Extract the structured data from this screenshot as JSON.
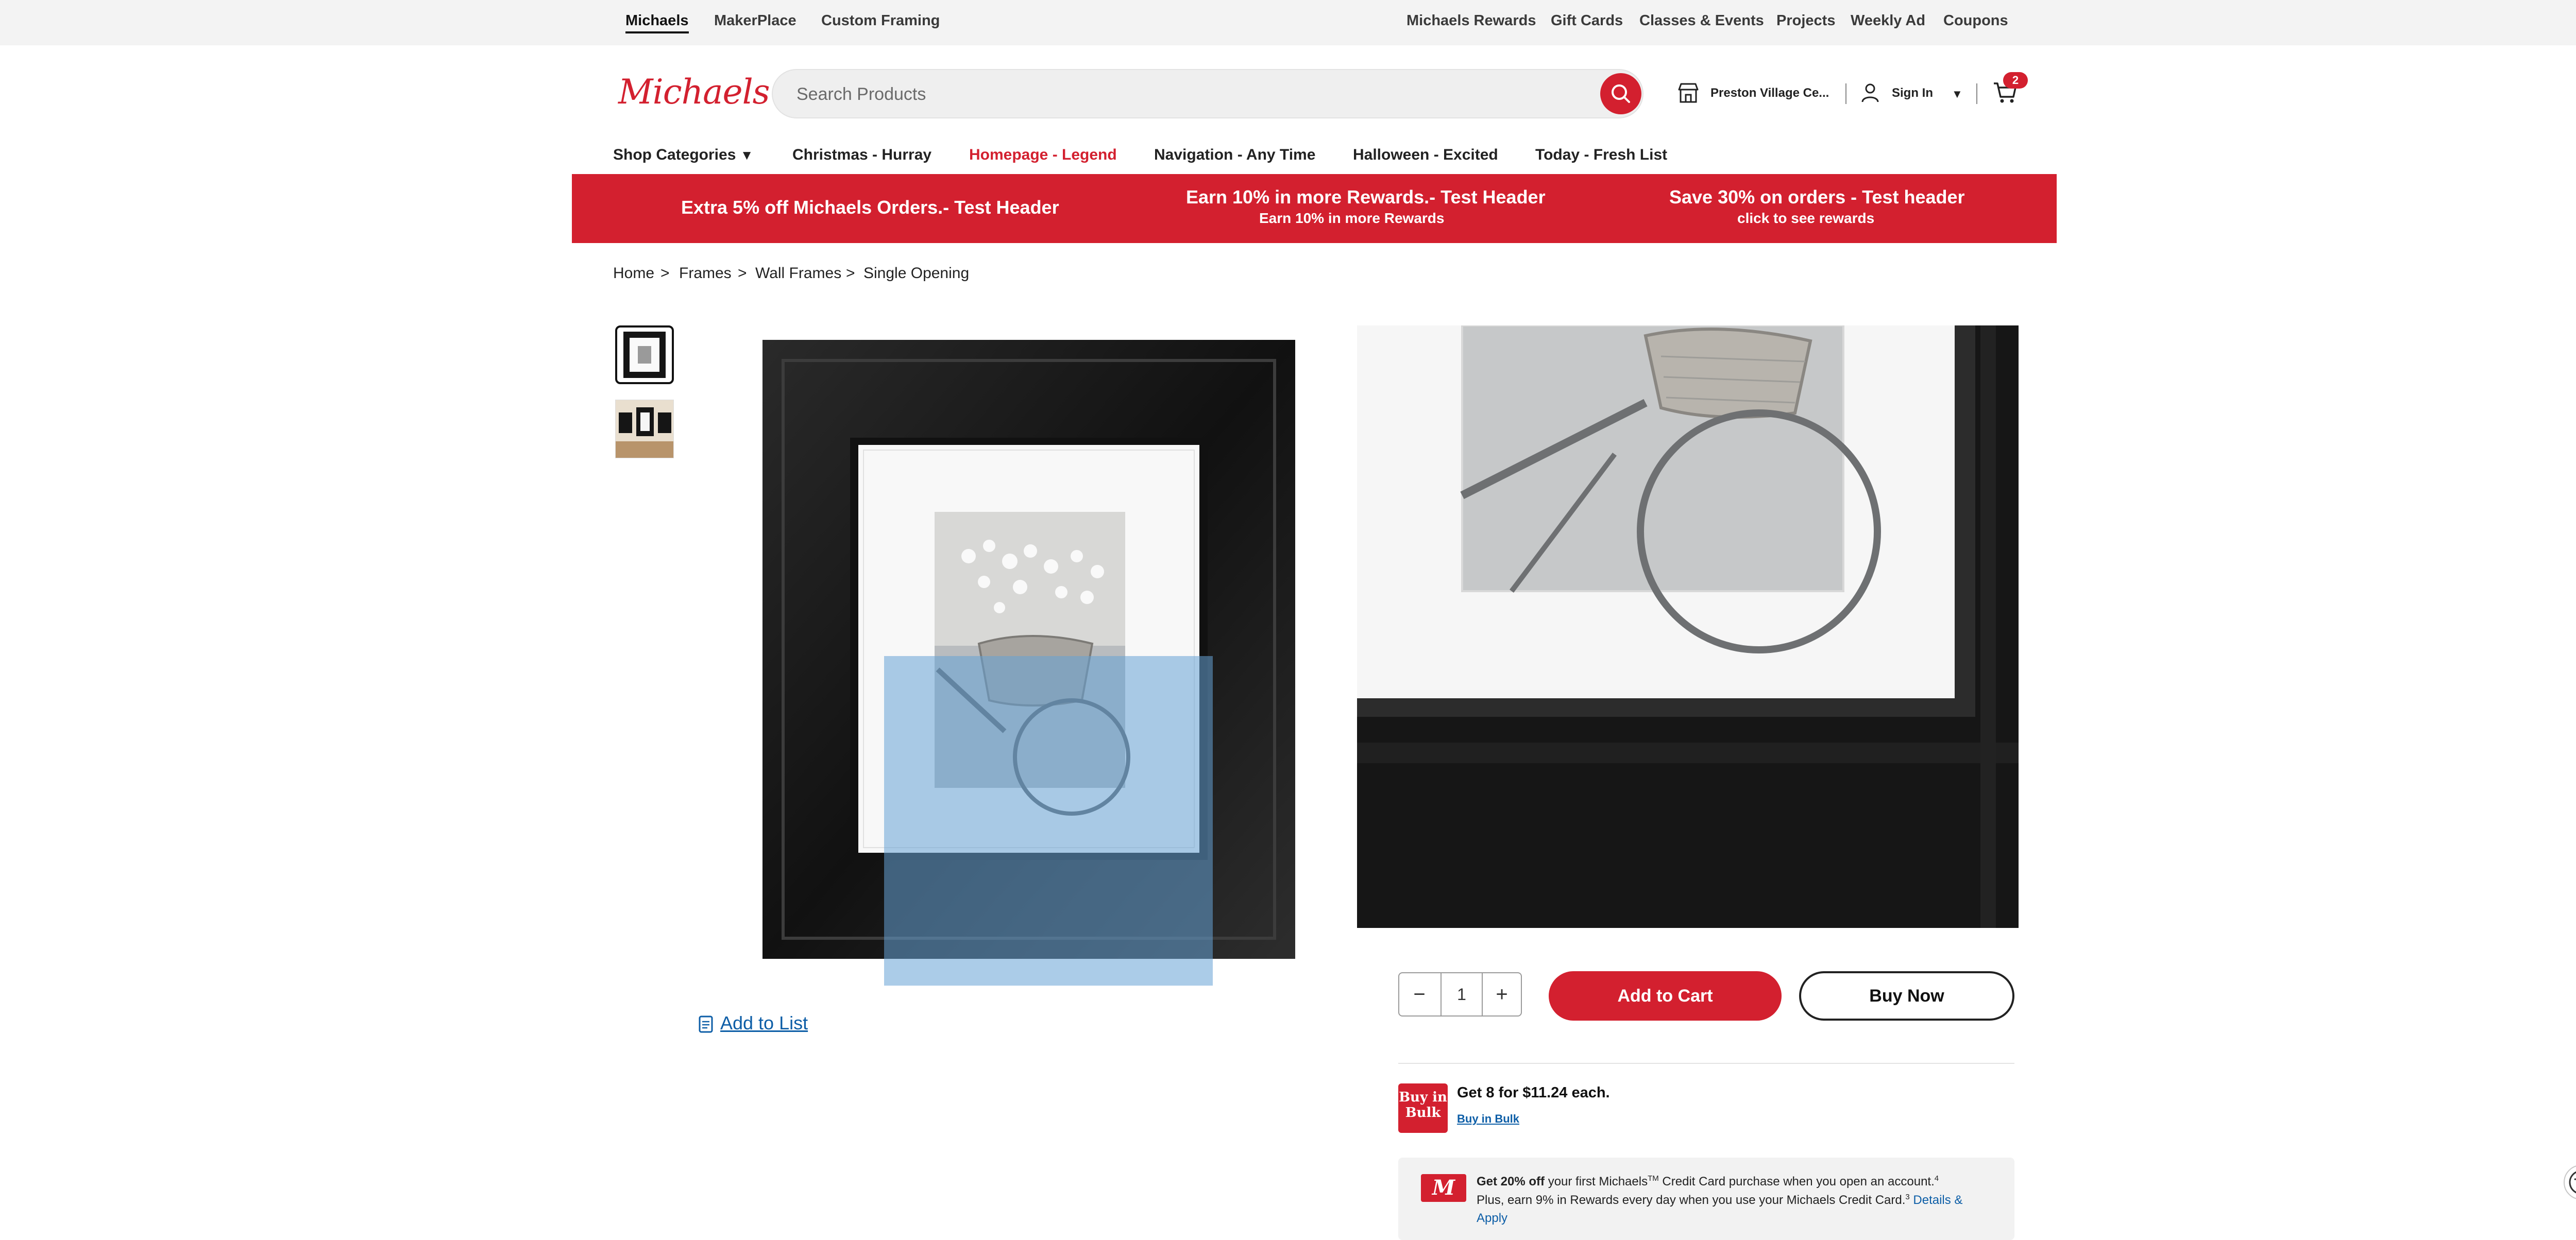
{
  "utility_nav": {
    "left": [
      "Michaels",
      "MakerPlace",
      "Custom Framing"
    ],
    "right": [
      "Michaels Rewards",
      "Gift Cards",
      "Classes & Events",
      "Projects",
      "Weekly Ad",
      "Coupons"
    ]
  },
  "header": {
    "logo_text": "Michaels",
    "search_placeholder": "Search Products",
    "store_label": "Preston Village Ce...",
    "signin_label": "Sign In",
    "cart_count": "2"
  },
  "main_nav": [
    "Shop Categories",
    "Christmas - Hurray",
    "Homepage - Legend",
    "Navigation - Any Time",
    "Halloween - Excited",
    "Today - Fresh List"
  ],
  "promo": [
    {
      "title": "Extra 5% off Michaels Orders.- Test Header",
      "subtitle": ""
    },
    {
      "title": "Earn 10% in more Rewards.- Test Header",
      "subtitle": "Earn 10% in more Rewards"
    },
    {
      "title": "Save 30% on orders - Test header",
      "subtitle": "click to see rewards"
    }
  ],
  "breadcrumb": [
    "Home",
    "Frames",
    "Wall Frames",
    "Single Opening"
  ],
  "breadcrumb_sep": ">",
  "product": {
    "add_to_list": "Add to List",
    "quantity": "1",
    "add_to_cart": "Add to Cart",
    "buy_now": "Buy Now",
    "bulk_icon_text": "Buy in Bulk",
    "bulk_offer": "Get 8 for $11.24 each.",
    "bulk_link": "Buy in Bulk"
  },
  "credit": {
    "logo": "M",
    "bold": "Get 20% off",
    "line1_a": " your first Michaels",
    "tm": "TM",
    "line1_b": " Credit Card purchase when you open an account.",
    "sup4": "4",
    "line2": "Plus, earn 9% in Rewards every day when you use your Michaels Credit Card.",
    "sup3": "3",
    "details": " Details &",
    "apply": "Apply"
  },
  "colors": {
    "brand_red": "#d3202f",
    "link_blue": "#0d5ea7",
    "lens": "#66a3d6"
  }
}
